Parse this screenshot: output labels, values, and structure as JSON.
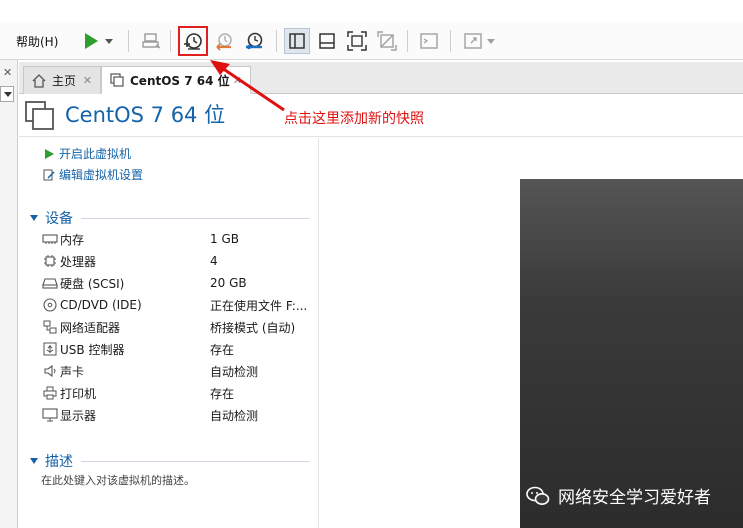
{
  "toolbar": {
    "help_menu": "帮助(H)"
  },
  "tabs": [
    {
      "label": "主页"
    },
    {
      "label": "CentOS 7 64 位"
    }
  ],
  "vm": {
    "title": "CentOS 7 64 位",
    "actions": [
      "开启此虚拟机",
      "编辑虚拟机设置"
    ]
  },
  "annotation": "点击这里添加新的快照",
  "devices": {
    "heading": "设备",
    "items": [
      {
        "icon": "memory-icon",
        "name": "内存",
        "value": "1 GB"
      },
      {
        "icon": "cpu-icon",
        "name": "处理器",
        "value": "4"
      },
      {
        "icon": "harddisk-icon",
        "name": "硬盘 (SCSI)",
        "value": "20 GB"
      },
      {
        "icon": "cd-dvd-icon",
        "name": "CD/DVD (IDE)",
        "value": "正在使用文件 F:..."
      },
      {
        "icon": "network-adapter-icon",
        "name": "网络适配器",
        "value": "桥接模式 (自动)"
      },
      {
        "icon": "usb-icon",
        "name": "USB 控制器",
        "value": "存在"
      },
      {
        "icon": "sound-card-icon",
        "name": "声卡",
        "value": "自动检测"
      },
      {
        "icon": "printer-icon",
        "name": "打印机",
        "value": "存在"
      },
      {
        "icon": "display-icon",
        "name": "显示器",
        "value": "自动检测"
      }
    ]
  },
  "description": {
    "heading": "描述",
    "placeholder": "在此处键入对该虚拟机的描述。"
  },
  "watermark": "网络安全学习爱好者",
  "colors": {
    "accent": "#1463a8",
    "annotation": "#e01010",
    "play": "#2e9e2e"
  }
}
